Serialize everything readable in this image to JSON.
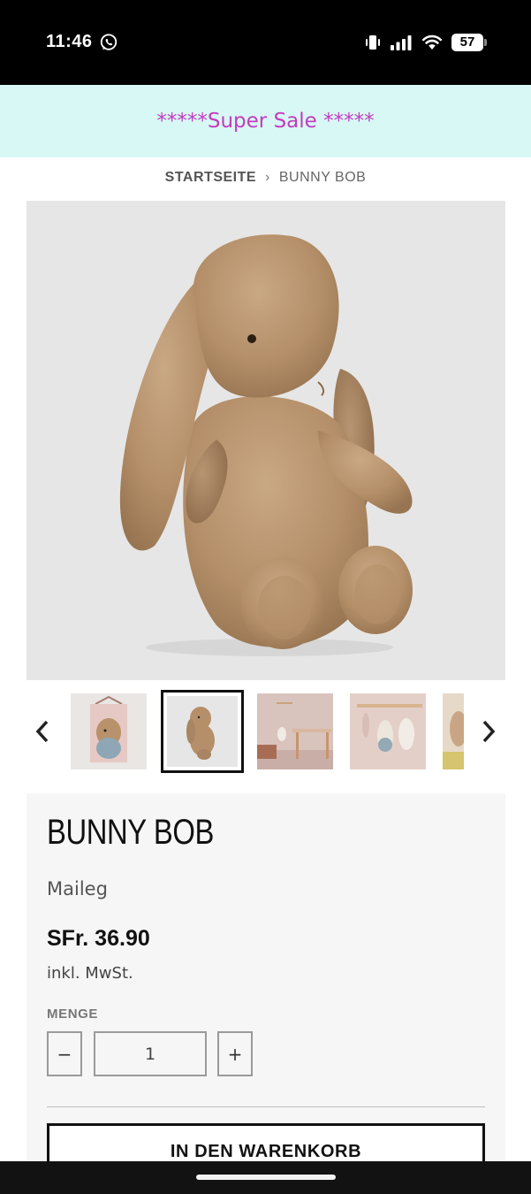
{
  "status_bar": {
    "time": "11:46",
    "battery": "57",
    "icons": [
      "whatsapp-icon",
      "vibrate-icon",
      "signal-icon",
      "wifi-icon",
      "battery-icon"
    ]
  },
  "promo": {
    "text": "*****Super Sale *****",
    "color": "#c33cc0",
    "background": "#d8f8f6"
  },
  "breadcrumb": {
    "home": "STARTSEITE",
    "separator": "›",
    "current": "BUNNY BOB"
  },
  "gallery": {
    "thumbnails": [
      "bunny-in-bag",
      "bunny-plush",
      "kids-room-desk",
      "bunnies-on-hooks",
      "bunny-partial"
    ],
    "selected_index": 1
  },
  "product": {
    "title": "BUNNY BOB",
    "vendor": "Maileg",
    "price": "SFr. 36.90",
    "tax_note": "inkl. MwSt.",
    "quantity_label": "MENGE",
    "quantity": "1",
    "minus": "−",
    "plus": "+",
    "add_to_cart": "IN DEN WARENKORB"
  }
}
